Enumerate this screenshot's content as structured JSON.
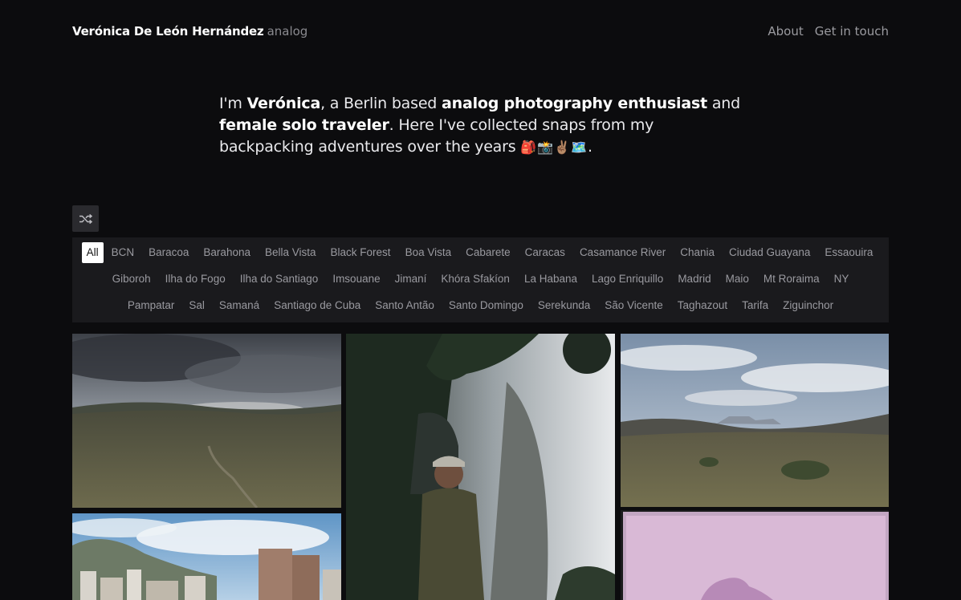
{
  "header": {
    "name": "Verónica De León Hernández",
    "tagline": "analog",
    "nav": [
      "About",
      "Get in touch"
    ]
  },
  "intro": {
    "t1": "I'm ",
    "b1": "Verónica",
    "t2": ", a Berlin based ",
    "b2": "analog photography enthusiast",
    "t3": " and ",
    "b3": "female solo traveler",
    "t4": ". Here I've collected snaps from my backpacking adventures over the years ",
    "emoji": "🎒📸✌🏽🗺️",
    "t5": "."
  },
  "shuffle_icon": "shuffle-icon",
  "filters": {
    "active": "All",
    "items": [
      "All",
      "BCN",
      "Baracoa",
      "Barahona",
      "Bella Vista",
      "Black Forest",
      "Boa Vista",
      "Cabarete",
      "Caracas",
      "Casamance River",
      "Chania",
      "Ciudad Guayana",
      "Essaouira",
      "Giboroh",
      "Ilha do Fogo",
      "Ilha do Santiago",
      "Imsouane",
      "Jimaní",
      "Khóra Sfakíon",
      "La Habana",
      "Lago Enriquillo",
      "Madrid",
      "Maio",
      "Mt Roraima",
      "NY",
      "Pampatar",
      "Sal",
      "Samaná",
      "Santiago de Cuba",
      "Santo Antão",
      "Santo Domingo",
      "Serekunda",
      "São Vicente",
      "Taghazout",
      "Tarifa",
      "Ziguinchor"
    ]
  },
  "colors": {
    "background": "#0c0c0e",
    "filter_bar": "#1a1a1d",
    "muted_text": "#9a9aa0"
  }
}
